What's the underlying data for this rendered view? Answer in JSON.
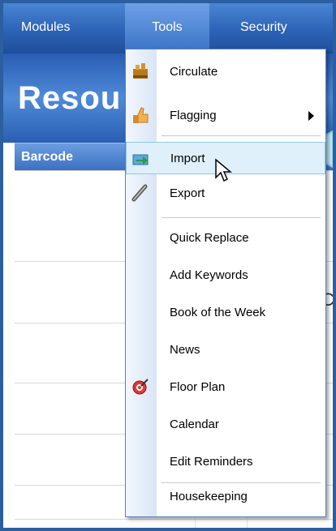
{
  "menubar": {
    "modules": "Modules",
    "tools": "Tools",
    "security": "Security"
  },
  "header": {
    "title": "Resou"
  },
  "table": {
    "column_barcode": "Barcode",
    "fragment_text": "C"
  },
  "tools_menu": {
    "items": [
      {
        "label": "Circulate",
        "icon": "circulate-icon"
      },
      {
        "label": "Flagging",
        "icon": "thumbs-up-icon",
        "has_submenu": true
      },
      {
        "label": "Import",
        "icon": "import-icon",
        "highlighted": true
      },
      {
        "label": "Export",
        "icon": "export-icon"
      },
      {
        "label": "Quick Replace"
      },
      {
        "label": "Add Keywords"
      },
      {
        "label": "Book of the Week"
      },
      {
        "label": "News"
      },
      {
        "label": "Floor Plan",
        "icon": "floor-plan-icon"
      },
      {
        "label": "Calendar"
      },
      {
        "label": "Edit Reminders"
      },
      {
        "label": "Housekeeping"
      }
    ]
  },
  "colors": {
    "menubar": "#2d62b6",
    "frame_border": "#2c5fa0",
    "highlight": "#dff0fa",
    "callout": "#8fd1ec"
  }
}
